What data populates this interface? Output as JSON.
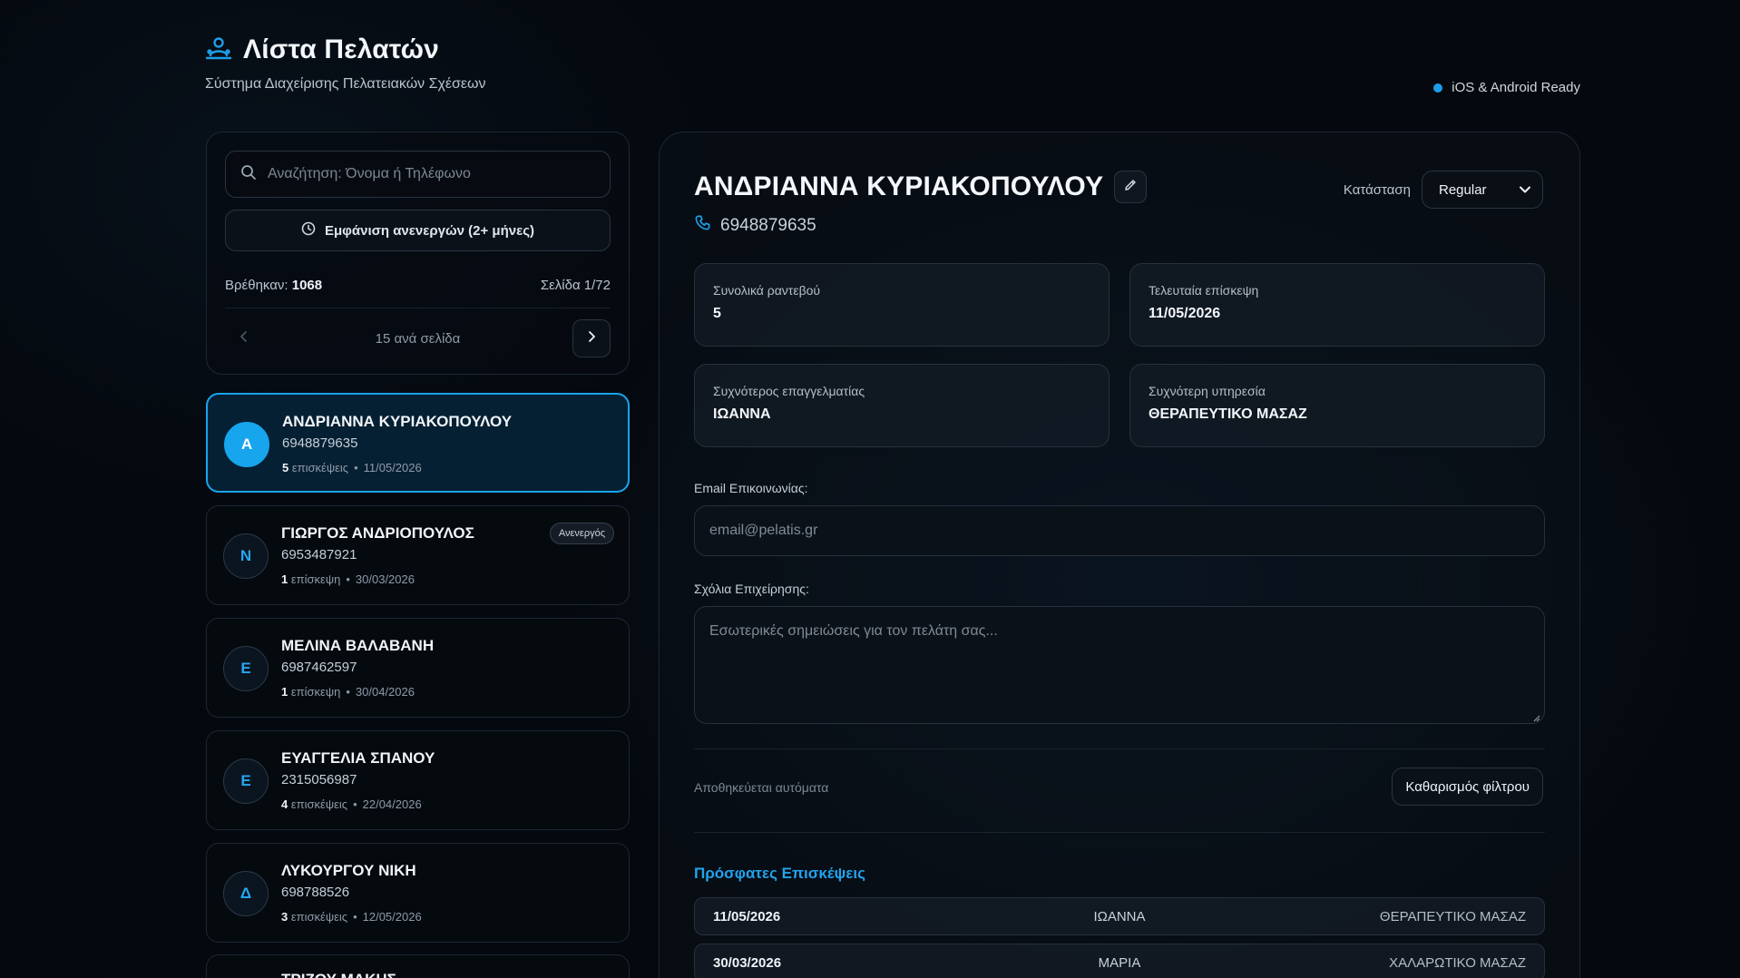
{
  "header": {
    "title": "Λίστα Πελατών",
    "subtitle": "Σύστημα Διαχείρισης Πελατειακών Σχέσεων",
    "platform_badge": "iOS & Android Ready",
    "accent_color": "#1e9ee8"
  },
  "filters": {
    "search_placeholder": "Αναζήτηση: Όνομα ή Τηλέφωνο",
    "inactive_button": "Εμφάνιση ανενεργών (2+ μήνες)",
    "found_label": "Βρέθηκαν:",
    "found_count": "1068",
    "page_info": "Σελίδα 1/72",
    "per_page": "15 ανά σελίδα"
  },
  "clients": [
    {
      "initial": "Α",
      "name": "ΑΝΔΡΙΑΝΝΑ ΚΥΡΙΑΚΟΠΟΥΛΟΥ",
      "phone": "6948879635",
      "visits": "5",
      "visits_label": "επισκέψεις",
      "last": "11/05/2026",
      "badge": ""
    },
    {
      "initial": "Ν",
      "name": "ΓΙΩΡΓΟΣ ΑΝΔΡΙΟΠΟΥΛΟΣ",
      "phone": "6953487921",
      "visits": "1",
      "visits_label": "επίσκεψη",
      "last": "30/03/2026",
      "badge": "Ανενεργός"
    },
    {
      "initial": "Ε",
      "name": "ΜΕΛΙΝΑ ΒΑΛΑΒΑΝΗ",
      "phone": "6987462597",
      "visits": "1",
      "visits_label": "επίσκεψη",
      "last": "30/04/2026",
      "badge": ""
    },
    {
      "initial": "Ε",
      "name": "ΕΥΑΓΓΕΛΙΑ ΣΠΑΝΟΥ",
      "phone": "2315056987",
      "visits": "4",
      "visits_label": "επισκέψεις",
      "last": "22/04/2026",
      "badge": ""
    },
    {
      "initial": "Δ",
      "name": "ΛΥΚΟΥΡΓΟΥ ΝΙΚΗ",
      "phone": "698788526",
      "visits": "3",
      "visits_label": "επισκέψεις",
      "last": "12/05/2026",
      "badge": ""
    },
    {
      "initial": "",
      "name": "ΤΡΙΖΟΥ ΜΑΚΗΣ",
      "phone": "",
      "visits": "",
      "visits_label": "",
      "last": "",
      "badge": ""
    }
  ],
  "detail": {
    "name": "ΑΝΔΡΙΑΝΝΑ ΚΥΡΙΑΚΟΠΟΥΛΟΥ",
    "phone": "6948879635",
    "status_label": "Κατάσταση",
    "status_value": "Regular",
    "stats": {
      "total_label": "Συνολικά ραντεβού",
      "total_value": "5",
      "last_label": "Τελευταία επίσκεψη",
      "last_value": "11/05/2026",
      "pro_label": "Συχνότερος επαγγελματίας",
      "pro_value": "ΙΩΑΝΝΑ",
      "service_label": "Συχνότερη υπηρεσία",
      "service_value": "ΘΕΡΑΠΕΥΤΙΚΟ ΜΑΣΑΖ"
    },
    "email_label": "Email Επικοινωνίας:",
    "email_placeholder": "email@pelatis.gr",
    "notes_label": "Σχόλια Επιχείρησης:",
    "notes_placeholder": "Εσωτερικές σημειώσεις για τον πελάτη σας...",
    "autosave": "Αποθηκεύεται αυτόματα",
    "clear_button": "Καθαρισμός φίλτρου",
    "visits_title": "Πρόσφατες Επισκέψεις",
    "visits": [
      {
        "date": "11/05/2026",
        "pro": "ΙΩΑΝΝΑ",
        "service": "ΘΕΡΑΠΕΥΤΙΚΟ ΜΑΣΑΖ"
      },
      {
        "date": "30/03/2026",
        "pro": "ΜΑΡΙΑ",
        "service": "ΧΑΛΑΡΩΤΙΚΟ ΜΑΣΑΖ"
      }
    ]
  }
}
